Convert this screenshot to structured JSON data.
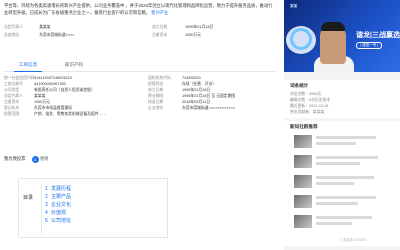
{
  "intro": {
    "text": "平台等，持续为各类高速增长的新兴产业提供，公司业务覆盖中 ，并于2020年创立以现代化管理和品牌化运营，致力于提升服务品质，推动行业转型升级。已成长为广东省级重点企业之一，备受行业客户的认可和信赖。",
    "link_text": "新兴产业"
  },
  "company_info": [
    {
      "key": "法定代表人",
      "value": "某某某"
    },
    {
      "key": "成立日期",
      "value": "1995年01月18日"
    },
    {
      "key": "总部地址",
      "value": "东莞市莞城街道××××"
    },
    {
      "key": "注册资本",
      "value": "1050万元"
    }
  ],
  "tabs": [
    {
      "label": "工商信息",
      "active": true
    },
    {
      "label": "知识产权",
      "active": false
    }
  ],
  "details": [
    {
      "key": "统一社会信用代码",
      "value": "91441900724892521X"
    },
    {
      "key": "组织机构代码",
      "value": "724892521"
    },
    {
      "key": "工商注册号",
      "value": "441900000467350"
    },
    {
      "key": "经营状态",
      "value": "存续（在营、开业）"
    },
    {
      "key": "公司类型",
      "value": "有限责任公司（自然人投资或控股）"
    },
    {
      "key": "成立日期",
      "value": "1995年01月18日"
    },
    {
      "key": "法定代表人",
      "value": "某某某"
    },
    {
      "key": "营业期限",
      "value": "1995年01月18日 至 无固定期限"
    },
    {
      "key": "注册资本",
      "value": "1050万元"
    },
    {
      "key": "核准日期",
      "value": "2018年05月11日"
    },
    {
      "key": "登记机关",
      "value": "东莞市市场监督管理局"
    },
    {
      "key": "企业地址",
      "value": "东莞市莞城街道××××××××××××"
    },
    {
      "key": "经营范围",
      "value": "产销、批发、零售各类机械设备及配件……"
    }
  ],
  "share": {
    "label": "我为我投票",
    "count": "0",
    "text": "感谢"
  },
  "toc": {
    "title": "目录",
    "items": [
      {
        "num": "1",
        "label": "发展历程"
      },
      {
        "num": "2",
        "label": "主要产品"
      },
      {
        "num": "3",
        "label": "企业文化"
      },
      {
        "num": "4",
        "label": "价值观"
      },
      {
        "num": "5",
        "label": "公司地址"
      }
    ]
  },
  "banner": {
    "logo": "某某",
    "headline": "谐龙|三战赢选",
    "subline": "| 强国一号 |",
    "brand_color": "#1b4fc4"
  },
  "stats_card": {
    "title": "词条统计",
    "stats": [
      {
        "label": "浏览次数：",
        "value": "3966次"
      },
      {
        "label": "编辑次数：",
        "value": "6次历史版本"
      },
      {
        "label": "最近更新：",
        "value": "2021-03-18"
      },
      {
        "label": "突出贡献者：",
        "value": "某某某"
      }
    ]
  },
  "news_card": {
    "title": "新知社群推荐",
    "watermark": "© 某某某 0000000"
  },
  "colors": {
    "accent": "#1a73e8"
  }
}
